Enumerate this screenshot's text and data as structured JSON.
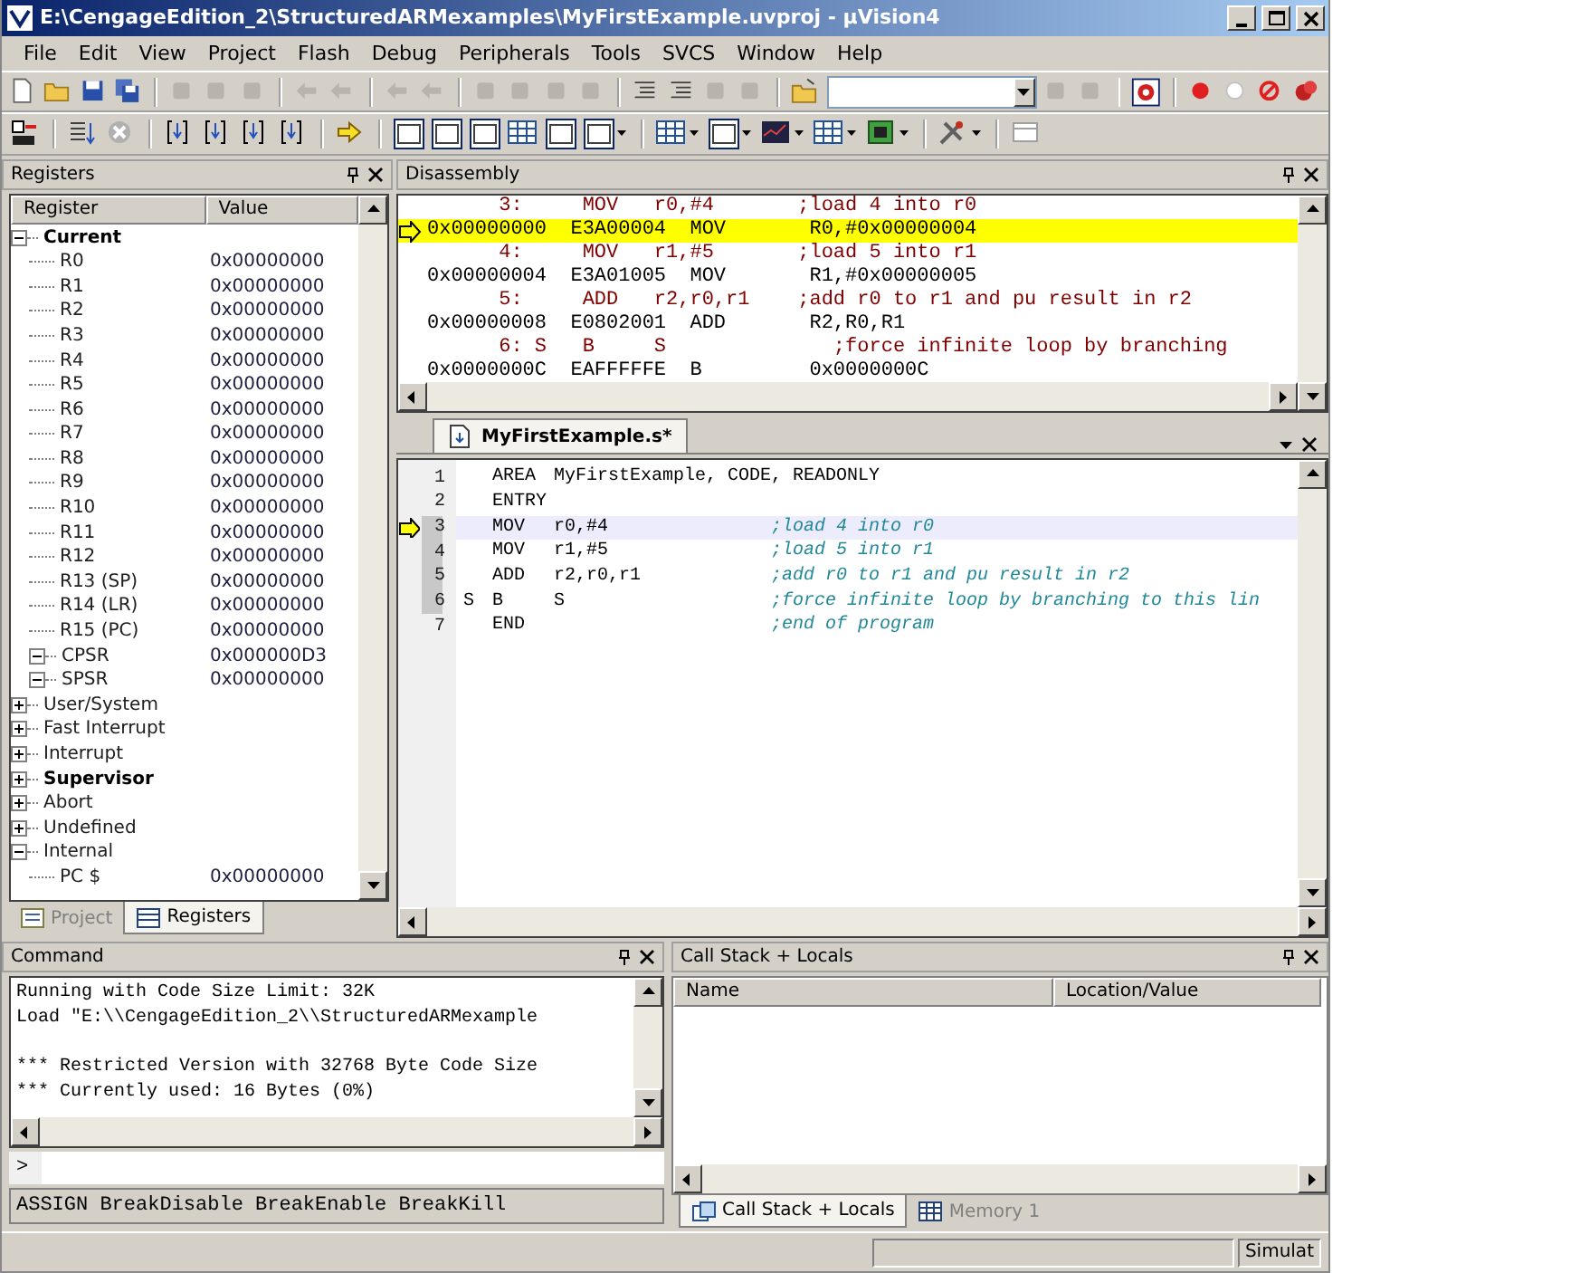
{
  "window": {
    "title": "E:\\CengageEdition_2\\StructuredARMexamples\\MyFirstExample.uvproj - µVision4"
  },
  "menu": [
    "File",
    "Edit",
    "View",
    "Project",
    "Flash",
    "Debug",
    "Peripherals",
    "Tools",
    "SVCS",
    "Window",
    "Help"
  ],
  "registers_panel": {
    "title": "Registers",
    "columns": [
      "Register",
      "Value"
    ],
    "tree": [
      {
        "name": "Current",
        "bold": true,
        "expanded": true,
        "children": [
          {
            "name": "R0",
            "value": "0x00000000"
          },
          {
            "name": "R1",
            "value": "0x00000000"
          },
          {
            "name": "R2",
            "value": "0x00000000"
          },
          {
            "name": "R3",
            "value": "0x00000000"
          },
          {
            "name": "R4",
            "value": "0x00000000"
          },
          {
            "name": "R5",
            "value": "0x00000000"
          },
          {
            "name": "R6",
            "value": "0x00000000"
          },
          {
            "name": "R7",
            "value": "0x00000000"
          },
          {
            "name": "R8",
            "value": "0x00000000"
          },
          {
            "name": "R9",
            "value": "0x00000000"
          },
          {
            "name": "R10",
            "value": "0x00000000"
          },
          {
            "name": "R11",
            "value": "0x00000000"
          },
          {
            "name": "R12",
            "value": "0x00000000"
          },
          {
            "name": "R13 (SP)",
            "value": "0x00000000"
          },
          {
            "name": "R14 (LR)",
            "value": "0x00000000"
          },
          {
            "name": "R15 (PC)",
            "value": "0x00000000"
          },
          {
            "name": "CPSR",
            "value": "0x000000D3",
            "expanded": true
          },
          {
            "name": "SPSR",
            "value": "0x00000000",
            "expanded": true
          }
        ]
      },
      {
        "name": "User/System",
        "bold": false,
        "expanded": false
      },
      {
        "name": "Fast Interrupt",
        "bold": false,
        "expanded": false
      },
      {
        "name": "Interrupt",
        "bold": false,
        "expanded": false
      },
      {
        "name": "Supervisor",
        "bold": true,
        "expanded": false
      },
      {
        "name": "Abort",
        "bold": false,
        "expanded": false
      },
      {
        "name": "Undefined",
        "bold": false,
        "expanded": false
      },
      {
        "name": "Internal",
        "bold": false,
        "expanded": true,
        "children": [
          {
            "name": "PC  $",
            "value": "0x00000000"
          }
        ]
      }
    ],
    "tabs": [
      {
        "label": "Project",
        "selected": false
      },
      {
        "label": "Registers",
        "selected": true
      }
    ]
  },
  "disassembly": {
    "title": "Disassembly",
    "lines": [
      {
        "kind": "source",
        "text": "      3:     MOV   r0,#4       ;load 4 into r0",
        "current": false
      },
      {
        "kind": "asm",
        "text": "0x00000000  E3A00004  MOV       R0,#0x00000004",
        "current": true
      },
      {
        "kind": "source",
        "text": "      4:     MOV   r1,#5       ;load 5 into r1",
        "current": false
      },
      {
        "kind": "asm",
        "text": "0x00000004  E3A01005  MOV       R1,#0x00000005",
        "current": false
      },
      {
        "kind": "source",
        "text": "      5:     ADD   r2,r0,r1    ;add r0 to r1 and pu result in r2",
        "current": false
      },
      {
        "kind": "asm",
        "text": "0x00000008  E0802001  ADD       R2,R0,R1",
        "current": false
      },
      {
        "kind": "source",
        "text": "      6: S   B     S              ;force infinite loop by branching",
        "current": false
      },
      {
        "kind": "asm",
        "text": "0x0000000C  EAFFFFFE  B         0x0000000C",
        "current": false
      }
    ]
  },
  "editor": {
    "tab": "MyFirstExample.s*",
    "lines": [
      {
        "number": "1",
        "op": "AREA",
        "operands": "MyFirstExample, CODE, READONLY",
        "executable": false,
        "current": false
      },
      {
        "number": "2",
        "op": "ENTRY",
        "executable": false,
        "current": false
      },
      {
        "number": "3",
        "op": "MOV",
        "operands": "r0,#4",
        "comment": ";load 4 into r0",
        "executable": true,
        "current": true
      },
      {
        "number": "4",
        "op": "MOV",
        "operands": "r1,#5",
        "comment": ";load 5 into r1",
        "executable": true,
        "current": false
      },
      {
        "number": "5",
        "op": "ADD",
        "operands": "r2,r0,r1",
        "comment": ";add r0 to r1 and pu result in r2",
        "executable": true,
        "current": false
      },
      {
        "number": "6",
        "label": "S",
        "op": "B",
        "operands": "S",
        "comment": ";force infinite loop by branching to this lin",
        "executable": true,
        "current": false
      },
      {
        "number": "7",
        "op": "END",
        "comment": ";end of program",
        "executable": false,
        "current": false
      }
    ]
  },
  "command": {
    "title": "Command",
    "output": [
      [
        "Running with Code Size Limit: 32K",
        "Load \"E:\\\\CengageEdition_2\\\\StructuredARMexample"
      ],
      [
        "*** Restricted Version with 32768 Byte Code Size",
        "*** Currently used: 16 Bytes (0%)"
      ]
    ],
    "prompt": ">",
    "help": "ASSIGN BreakDisable BreakEnable BreakKill"
  },
  "call_stack": {
    "title": "Call Stack + Locals",
    "columns": [
      "Name",
      "Location/Value"
    ],
    "tabs": [
      {
        "label": "Call Stack + Locals",
        "selected": true
      },
      {
        "label": "Memory 1",
        "selected": false
      }
    ]
  },
  "status_bar": {
    "mode": "Simulat"
  }
}
